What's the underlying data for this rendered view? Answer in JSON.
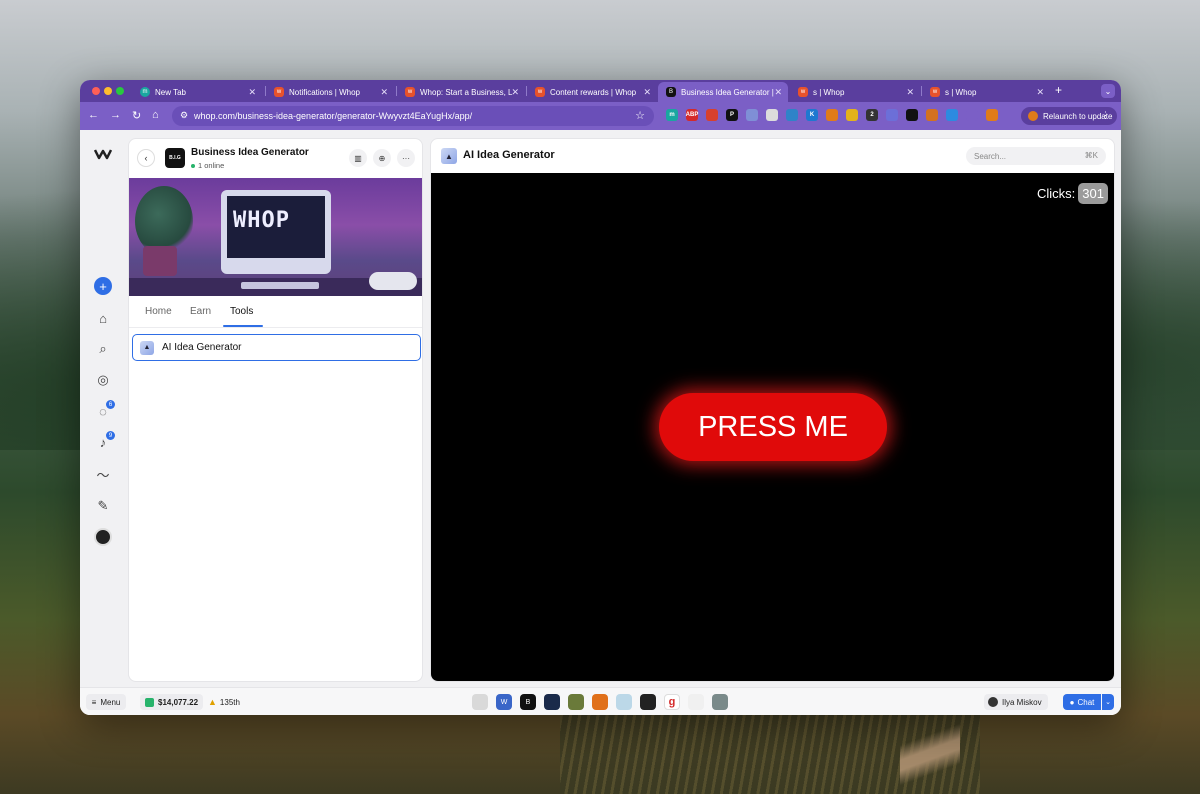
{
  "browser": {
    "tabs": [
      {
        "title": "New Tab",
        "favicon_color": "#1aa7a0",
        "favicon": "m"
      },
      {
        "title": "Notifications | Whop",
        "favicon_color": "#e8522b",
        "favicon": "w"
      },
      {
        "title": "Whop: Start a Business, L",
        "favicon_color": "#e8522b",
        "favicon": "w"
      },
      {
        "title": "Content rewards | Whop",
        "favicon_color": "#e8522b",
        "favicon": "w"
      },
      {
        "title": "Business Idea Generator |",
        "favicon_color": "#111111",
        "favicon": "B"
      },
      {
        "title": "s | Whop",
        "favicon_color": "#e8522b",
        "favicon": "w"
      },
      {
        "title": "s | Whop",
        "favicon_color": "#e8522b",
        "favicon": "w"
      }
    ],
    "url": "whop.com/business-idea-generator/generator-Wwyvzt4EaYugHx/app/",
    "relaunch_label": "Relaunch to update",
    "extensions": [
      {
        "name": "m-extension-icon",
        "color": "#1aa7a0",
        "label": "m"
      },
      {
        "name": "abp-extension-icon",
        "color": "#d42a2a",
        "label": "ABP"
      },
      {
        "name": "red-extension-icon",
        "color": "#d8402c",
        "label": ""
      },
      {
        "name": "p-extension-icon",
        "color": "#111111",
        "label": "P"
      },
      {
        "name": "puzzle-blue-extension-icon",
        "color": "#7f8fd6",
        "label": ""
      },
      {
        "name": "doc-extension-icon",
        "color": "#dcdcdc",
        "label": ""
      },
      {
        "name": "globe-extension-icon",
        "color": "#2f83c8",
        "label": ""
      },
      {
        "name": "k-extension-icon",
        "color": "#1e78d0",
        "label": "K"
      },
      {
        "name": "orange-extension-icon",
        "color": "#e07b1a",
        "label": ""
      },
      {
        "name": "shield-extension-icon",
        "color": "#e3b21b",
        "label": ""
      },
      {
        "name": "badge-extension-icon",
        "color": "#333333",
        "label": "2"
      },
      {
        "name": "chart-extension-icon",
        "color": "#6c6fd8",
        "label": ""
      },
      {
        "name": "lock-extension-icon",
        "color": "#111111",
        "label": ""
      },
      {
        "name": "fox-extension-icon",
        "color": "#d3711f",
        "label": ""
      },
      {
        "name": "drive-extension-icon",
        "color": "#2c8be0",
        "label": ""
      },
      {
        "name": "puzzle-extension-icon",
        "color": "#7b5fc6",
        "label": ""
      },
      {
        "name": "profile-extension-icon",
        "color": "#e07b1a",
        "label": ""
      }
    ]
  },
  "sidebar": {
    "badges": {
      "messages": "6",
      "notifications": "9"
    }
  },
  "panel": {
    "title": "Business Idea Generator",
    "online": "1 online",
    "logo_text": "B.I.G",
    "tabs": [
      {
        "label": "Home"
      },
      {
        "label": "Earn"
      },
      {
        "label": "Tools"
      }
    ],
    "tool_item": "AI Idea Generator",
    "banner_text": "WHOP"
  },
  "main": {
    "title": "AI Idea Generator",
    "search_placeholder": "Search...",
    "search_shortcut": "⌘K",
    "clicks_label": "Clicks:",
    "clicks_value": "301",
    "press_label": "PRESS ME"
  },
  "bottom": {
    "menu_label": "Menu",
    "balance": "$14,077.22",
    "rank": "135th",
    "user": "Ilya Miskov",
    "chat_label": "Chat",
    "dock": [
      {
        "name": "dock-app-1",
        "color": "#d9d9d9",
        "label": ""
      },
      {
        "name": "dock-app-whop",
        "color": "#3a66c8",
        "label": "W"
      },
      {
        "name": "dock-app-big",
        "color": "#111111",
        "label": "B"
      },
      {
        "name": "dock-app-globe",
        "color": "#1a2a4a",
        "label": ""
      },
      {
        "name": "dock-app-game",
        "color": "#6a7a3a",
        "label": ""
      },
      {
        "name": "dock-app-fire",
        "color": "#e0701a",
        "label": ""
      },
      {
        "name": "dock-app-light",
        "color": "#bcd8e8",
        "label": ""
      },
      {
        "name": "dock-app-dark",
        "color": "#222222",
        "label": ""
      },
      {
        "name": "dock-app-g",
        "color": "#ffffff",
        "label": "g"
      },
      {
        "name": "dock-app-text",
        "color": "#f0f0f0",
        "label": ""
      },
      {
        "name": "dock-app-photo",
        "color": "#7a8a8a",
        "label": ""
      }
    ]
  }
}
